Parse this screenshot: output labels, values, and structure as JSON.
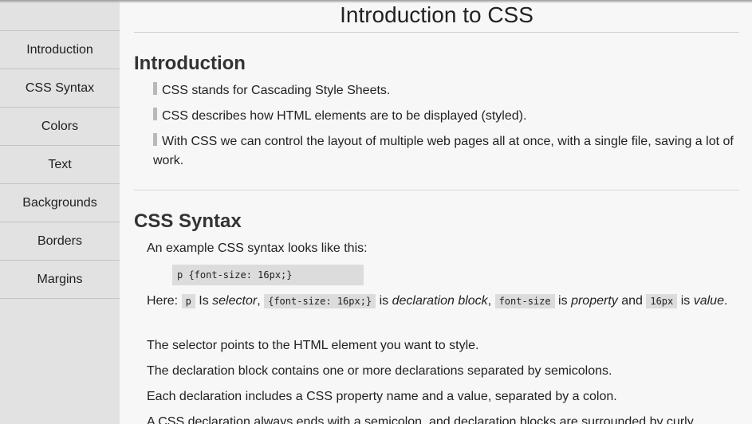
{
  "sidebar": {
    "items": [
      {
        "label": "Introduction"
      },
      {
        "label": "CSS Syntax"
      },
      {
        "label": "Colors"
      },
      {
        "label": "Text"
      },
      {
        "label": "Backgrounds"
      },
      {
        "label": "Borders"
      },
      {
        "label": "Margins"
      }
    ]
  },
  "page": {
    "title": "Introduction to CSS"
  },
  "intro": {
    "heading": "Introduction",
    "bullets": [
      "CSS stands for Cascading Style Sheets.",
      "CSS describes how HTML elements are to be displayed (styled).",
      "With CSS we can control the layout of multiple web pages all at once, with a single file, saving a lot of work."
    ]
  },
  "syntax": {
    "heading": "CSS Syntax",
    "lead": "An example CSS syntax looks like this:",
    "example_code": "p {font-size: 16px;}",
    "explain": {
      "here": "Here:",
      "code_p": "p",
      "is1": " Is ",
      "selector": "selector",
      "comma1": ",",
      "code_block": "{font-size: 16px;}",
      "is2": " is ",
      "declaration_block": "declaration block",
      "comma2": ",",
      "code_prop": "font-size",
      "is3": " is ",
      "property": "property",
      "and": " and ",
      "code_value": "16px",
      "is4": " is ",
      "value": "value",
      "period": "."
    },
    "paragraphs": [
      "The selector points to the HTML element you want to style.",
      "The declaration block contains one or more declarations separated by semicolons.",
      "Each declaration includes a CSS property name and a value, separated by a colon.",
      "A CSS declaration always ends with a semicolon, and declaration blocks are surrounded by curly"
    ]
  }
}
